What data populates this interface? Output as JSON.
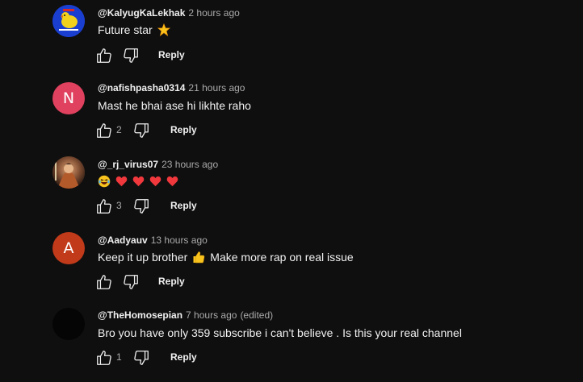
{
  "comments": [
    {
      "author": "@KalyugKaLekhak",
      "time": "2 hours ago",
      "text": "Future star",
      "emoji": "glowing-star",
      "likes": "",
      "reply_label": "Reply",
      "avatar_letter": "",
      "avatar_color": "#1a3fd0"
    },
    {
      "author": "@nafishpasha0314",
      "time": "21 hours ago",
      "text": "Mast he bhai ase hi likhte raho",
      "likes": "2",
      "reply_label": "Reply",
      "avatar_letter": "N",
      "avatar_color": "#e0415e"
    },
    {
      "author": "@_rj_virus07",
      "time": "23 hours ago",
      "text": "",
      "emoji": "laughing-face, red-heart x4",
      "likes": "3",
      "reply_label": "Reply",
      "avatar_letter": "",
      "avatar_color": "#5a3a2a"
    },
    {
      "author": "@Aadyauv",
      "time": "13 hours ago",
      "text_before": "Keep it up brother",
      "emoji": "thumbs-up",
      "text_after": "Make more rap on real issue",
      "likes": "",
      "reply_label": "Reply",
      "avatar_letter": "A",
      "avatar_color": "#c13a1a"
    },
    {
      "author": "@TheHomosepian",
      "time": "7 hours ago",
      "edited": "(edited)",
      "text": "Bro you have only 359 subscribe i can't believe . Is this your real channel",
      "likes": "1",
      "reply_label": "Reply",
      "avatar_letter": "",
      "avatar_color": "#050505"
    }
  ]
}
